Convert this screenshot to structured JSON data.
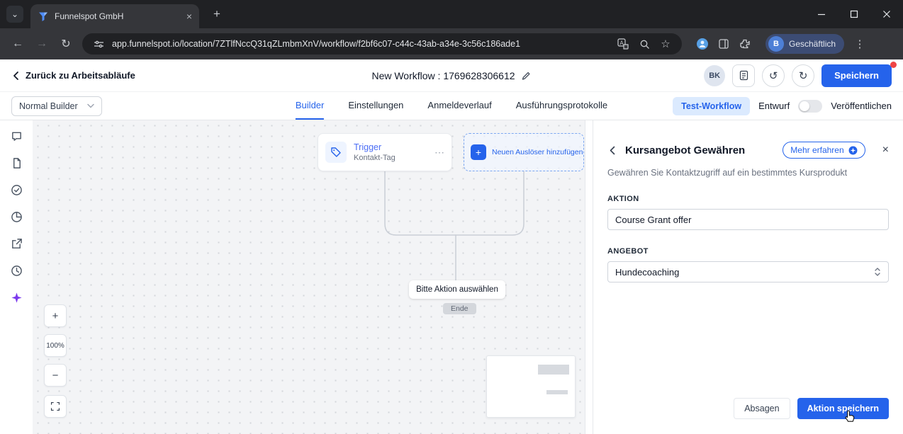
{
  "browser": {
    "tab_title": "Funnelspot GmbH",
    "url": "app.funnelspot.io/location/7ZTlfNccQ31qZLmbmXnV/workflow/f2bf6c07-c44c-43ab-a34e-3c56c186ade1",
    "profile": {
      "initial": "B",
      "label": "Geschäftlich"
    }
  },
  "icons": {
    "caret": "⌄",
    "new_tab": "+",
    "close": "×",
    "back": "←",
    "forward": "→",
    "reload": "↻",
    "star": "☆",
    "kebab": "⋮",
    "ellipsis": "⋯",
    "undo": "↺",
    "redo": "↻",
    "plus": "+",
    "minus": "−"
  },
  "header": {
    "back_label": "Zurück zu Arbeitsabläufe",
    "title": "New Workflow : 1769628306612",
    "avatar_initials": "BK",
    "save_label": "Speichern"
  },
  "toolbar": {
    "builder_mode": "Normal Builder",
    "tabs": [
      "Builder",
      "Einstellungen",
      "Anmeldeverlauf",
      "Ausführungsprotokolle"
    ],
    "active_tab": "Builder",
    "test_workflow_label": "Test-Workflow",
    "draft_label": "Entwurf",
    "publish_label": "Veröffentlichen"
  },
  "canvas": {
    "trigger_title": "Trigger",
    "trigger_subtitle": "Kontakt-Tag",
    "add_trigger_label": "Neuen Auslöser hinzufügen",
    "select_action_label": "Bitte Aktion auswählen",
    "end_label": "Ende",
    "zoom_level": "100%"
  },
  "panel": {
    "title": "Kursangebot Gewähren",
    "learn_more_label": "Mehr erfahren",
    "description": "Gewähren Sie Kontaktzugriff auf ein bestimmtes Kursprodukt",
    "action_field": {
      "label": "AKTION",
      "value": "Course Grant offer"
    },
    "offer_field": {
      "label": "ANGEBOT",
      "value": "Hundecoaching"
    },
    "cancel_label": "Absagen",
    "save_label": "Aktion speichern"
  },
  "colors": {
    "accent_blue": "#2563eb",
    "light_blue": "#dbeafe",
    "rail_purple": "#7c3aed",
    "notification_red": "#ef4444"
  }
}
